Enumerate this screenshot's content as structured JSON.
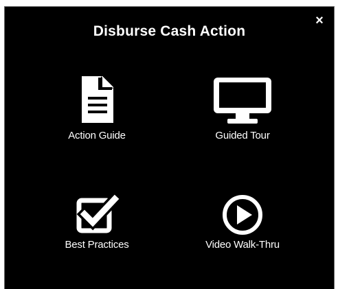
{
  "dialog": {
    "title": "Disburse Cash Action",
    "close_symbol": "×"
  },
  "options": [
    {
      "label": "Action Guide",
      "icon": "document-icon"
    },
    {
      "label": "Guided Tour",
      "icon": "monitor-icon"
    },
    {
      "label": "Best Practices",
      "icon": "checkbox-icon"
    },
    {
      "label": "Video Walk-Thru",
      "icon": "play-circle-icon"
    }
  ],
  "colors": {
    "background": "#000000",
    "foreground": "#ffffff",
    "border": "#6a6a6a"
  }
}
